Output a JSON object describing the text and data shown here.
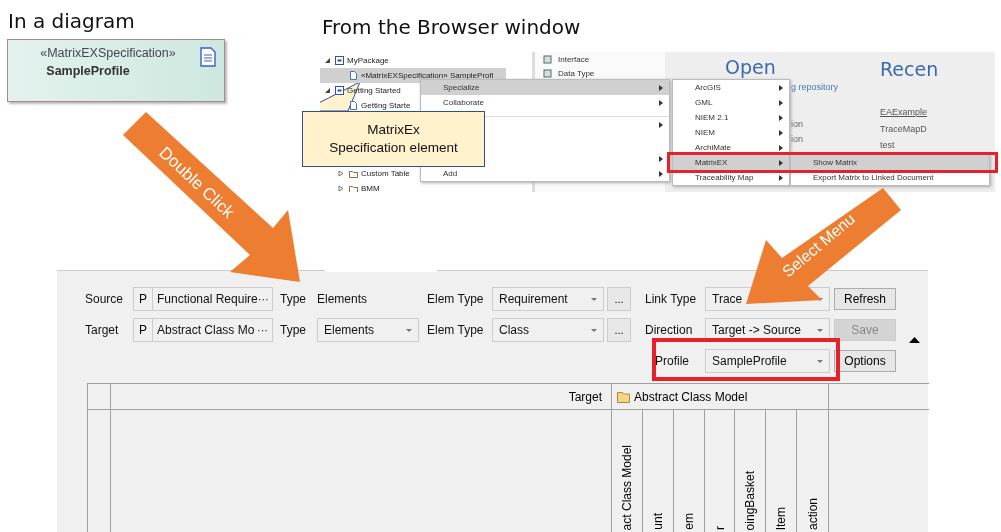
{
  "diagram_section": {
    "heading": "In a diagram",
    "element": {
      "stereotype": "«MatrixEXSpecification»",
      "name": "SampleProfile"
    }
  },
  "browser_section": {
    "heading": "From the Browser window",
    "tree": [
      {
        "label": "MyPackage",
        "expanded": true,
        "selected": false,
        "children": [
          {
            "label": "«MatrixEXSpecification» SampleProfi",
            "selected": true
          }
        ]
      },
      {
        "label": "Getting Started",
        "expanded": true,
        "selected": false,
        "children": [
          {
            "label": "Getting Starte",
            "selected": false
          },
          {
            "label": "Custom Table",
            "expanded": false,
            "selected": false
          },
          {
            "label": "BMM",
            "expanded": false,
            "selected": false
          }
        ]
      }
    ],
    "toolbox": [
      "Interface",
      "Data Type"
    ],
    "context_menu": [
      {
        "label": "Specialize",
        "selected": true
      },
      {
        "label": "Collaborate",
        "selected": false
      },
      {
        "selected": false
      },
      {
        "selected": false
      },
      {
        "label": "Add",
        "selected": false
      }
    ],
    "submenu": [
      {
        "label": "ArcGIS",
        "selected": false
      },
      {
        "label": "GML",
        "selected": false
      },
      {
        "label": "NIEM 2.1",
        "selected": false
      },
      {
        "label": "NIEM",
        "selected": false
      },
      {
        "label": "ArchiMate",
        "selected": false
      },
      {
        "label": "MatrixEX",
        "selected": true
      },
      {
        "label": "Traceability Map",
        "selected": false
      }
    ],
    "submenu2": [
      {
        "label": "Show Matrix",
        "selected": true
      },
      {
        "label": "Export Matrix to Linked Document",
        "selected": false
      }
    ],
    "start_page": {
      "open_title": "Open",
      "open_items": [
        "g repository",
        "ion",
        "ion"
      ],
      "recent_title": "Recen",
      "recent_items": [
        {
          "label": "EAExample",
          "link": true
        },
        {
          "label": "TraceMapD",
          "link": false
        },
        {
          "label": "test",
          "link": false
        }
      ]
    },
    "callout": [
      "MatrixEx",
      "Specification element"
    ]
  },
  "arrows": [
    {
      "label": "Double Click"
    },
    {
      "label": "Select Menu"
    }
  ],
  "matrix_panel": {
    "source": {
      "label": "Source",
      "package_button": "P",
      "value": "Functional Require",
      "ellipsis": "···",
      "type": {
        "kind": "text",
        "label": "Type",
        "value": "Elements"
      },
      "elem_type_label": "Elem Type",
      "elem_type": "Requirement",
      "browse": "..."
    },
    "target": {
      "label": "Target",
      "package_button": "P",
      "value": "Abstract Class Mo",
      "ellipsis": "···",
      "type": {
        "kind": "dropdown",
        "label": "Type",
        "value": "Elements"
      },
      "elem_type_label": "Elem Type",
      "elem_type": "Class",
      "browse": "..."
    },
    "link_type": {
      "label": "Link Type",
      "value": "Trace"
    },
    "direction": {
      "label": "Direction",
      "value": "Target -> Source"
    },
    "profile": {
      "label": "Profile",
      "value": "SampleProfile"
    },
    "buttons": [
      {
        "label": "Refresh",
        "disabled": false
      },
      {
        "label": "Save",
        "disabled": true
      },
      {
        "label": "Options",
        "disabled": false
      }
    ],
    "grid": {
      "corner_label": "Target",
      "package": "Abstract Class Model",
      "columns": [
        "act Class Model",
        "unt",
        "em",
        "r",
        "oingBasket",
        "Item",
        "action"
      ]
    }
  }
}
